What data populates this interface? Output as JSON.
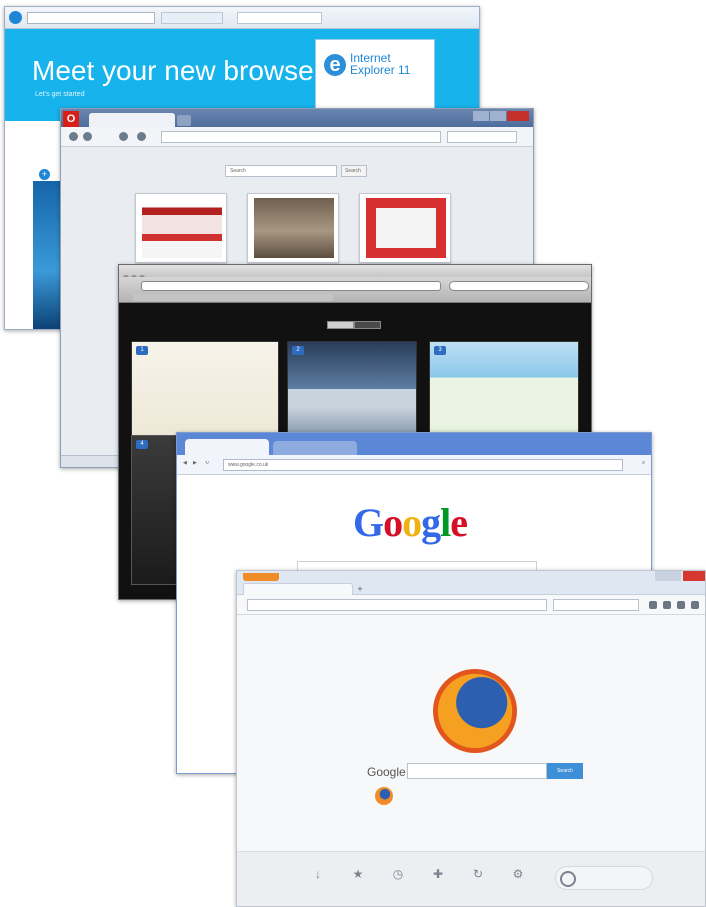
{
  "ie": {
    "headline": "Meet your new browse",
    "subline": "Let's get started",
    "promo_brand_line1": "Internet",
    "promo_brand_line2": "Explorer 11",
    "icon": "ie-logo-icon",
    "accent": "#16b3ec"
  },
  "opera": {
    "icon": "opera-logo-icon",
    "speed_dial_search_placeholder": "Search",
    "speed_dial_search_button": "Search",
    "accent": "#d91e18"
  },
  "safari": {
    "icon": "safari-window",
    "tiles": [
      "1",
      "2",
      "3",
      "4"
    ]
  },
  "chrome": {
    "address": "www.google.co.uk",
    "logo": {
      "letters": [
        "G",
        "o",
        "o",
        "g",
        "l",
        "e"
      ],
      "colors": [
        "#3369e8",
        "#d50f25",
        "#eeb211",
        "#3369e8",
        "#009925",
        "#d50f25"
      ]
    },
    "accent": "#5c86d6"
  },
  "firefox": {
    "search_label": "Google",
    "search_button": "Search",
    "icon": "firefox-logo-icon",
    "accent": "#f08c28",
    "launcher": [
      {
        "icon": "download-icon",
        "glyph": "↓"
      },
      {
        "icon": "bookmark-star-icon",
        "glyph": "★"
      },
      {
        "icon": "history-clock-icon",
        "glyph": "◷"
      },
      {
        "icon": "addons-puzzle-icon",
        "glyph": "✚"
      },
      {
        "icon": "sync-icon",
        "glyph": "↻"
      },
      {
        "icon": "settings-gear-icon",
        "glyph": "⚙"
      }
    ]
  }
}
